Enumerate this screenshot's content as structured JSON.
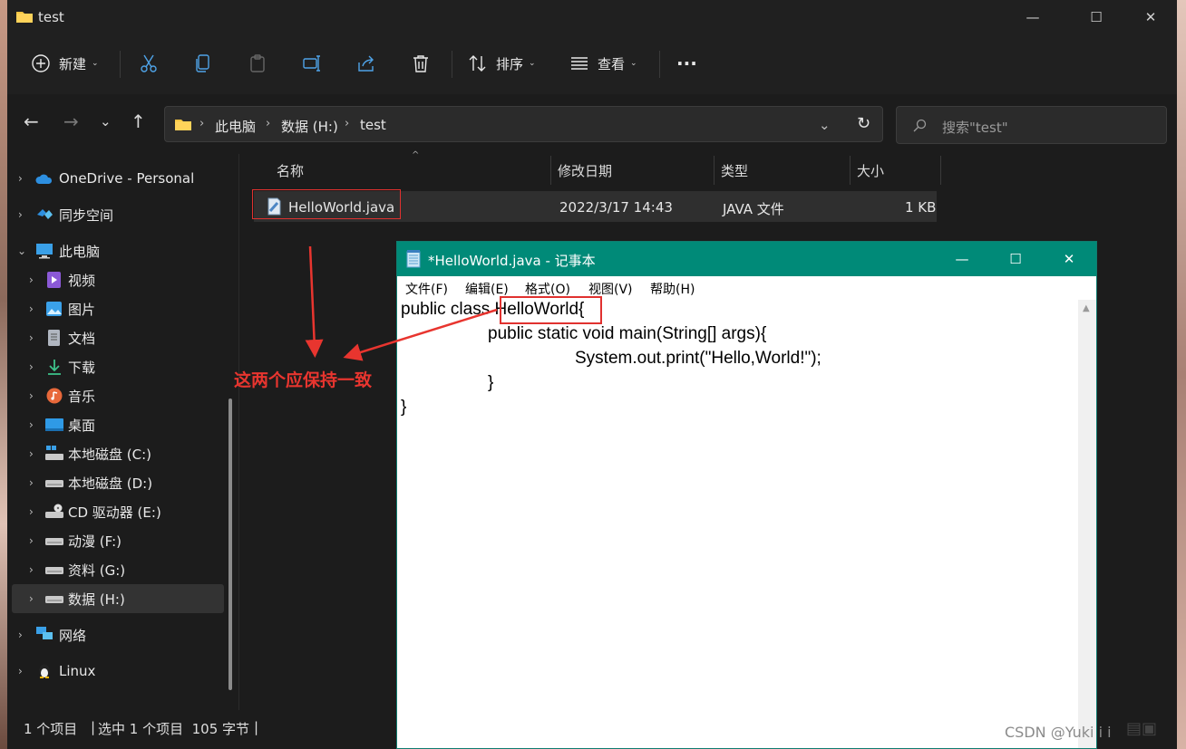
{
  "explorer": {
    "title": "test",
    "window_controls": [
      "—",
      "☐",
      "✕"
    ],
    "toolbar": {
      "new_label": "新建",
      "sort_label": "排序",
      "view_label": "查看",
      "more_label": "···"
    },
    "address": {
      "segments": [
        "此电脑",
        "数据 (H:)",
        "test"
      ],
      "search_placeholder": "搜索\"test\""
    },
    "sidebar": [
      {
        "label": "OneDrive - Personal",
        "icon": "onedrive-icon"
      },
      {
        "label": "同步空间",
        "icon": "sync-space-icon"
      },
      {
        "label": "此电脑",
        "icon": "pc-icon"
      },
      {
        "label": "视频",
        "icon": "video-icon"
      },
      {
        "label": "图片",
        "icon": "picture-icon"
      },
      {
        "label": "文档",
        "icon": "document-icon"
      },
      {
        "label": "下载",
        "icon": "download-icon"
      },
      {
        "label": "音乐",
        "icon": "music-icon"
      },
      {
        "label": "桌面",
        "icon": "desktop-icon"
      },
      {
        "label": "本地磁盘 (C:)",
        "icon": "drive-icon"
      },
      {
        "label": "本地磁盘 (D:)",
        "icon": "drive-icon"
      },
      {
        "label": "CD 驱动器 (E:)",
        "icon": "cd-drive-icon"
      },
      {
        "label": "动漫 (F:)",
        "icon": "drive-icon"
      },
      {
        "label": "资料 (G:)",
        "icon": "drive-icon"
      },
      {
        "label": "数据 (H:)",
        "icon": "drive-icon"
      },
      {
        "label": "网络",
        "icon": "network-icon"
      },
      {
        "label": "Linux",
        "icon": "linux-icon"
      }
    ],
    "columns": [
      "名称",
      "修改日期",
      "类型",
      "大小"
    ],
    "files": [
      {
        "name": "HelloWorld.java",
        "modified": "2022/3/17 14:43",
        "type": "JAVA 文件",
        "size": "1 KB"
      }
    ],
    "status": {
      "item_count": "1 个项目",
      "selected": "选中 1 个项目  105 字节"
    }
  },
  "notepad": {
    "title": "*HelloWorld.java - 记事本",
    "window_controls": [
      "—",
      "☐",
      "✕"
    ],
    "menu": [
      "文件(F)",
      "编辑(E)",
      "格式(O)",
      "视图(V)",
      "帮助(H)"
    ],
    "code_lines": [
      "public class HelloWorld{",
      "public static void main(String[] args){",
      "System.out.print(\"Hello,World!\");",
      "}",
      "}"
    ]
  },
  "annotation": "这两个应保持一致",
  "watermark": "CSDN @Yuki i i",
  "colors": {
    "accent_red": "#e0312f",
    "notepad_title": "#008a78",
    "explorer_bg": "#1c1c1c"
  }
}
